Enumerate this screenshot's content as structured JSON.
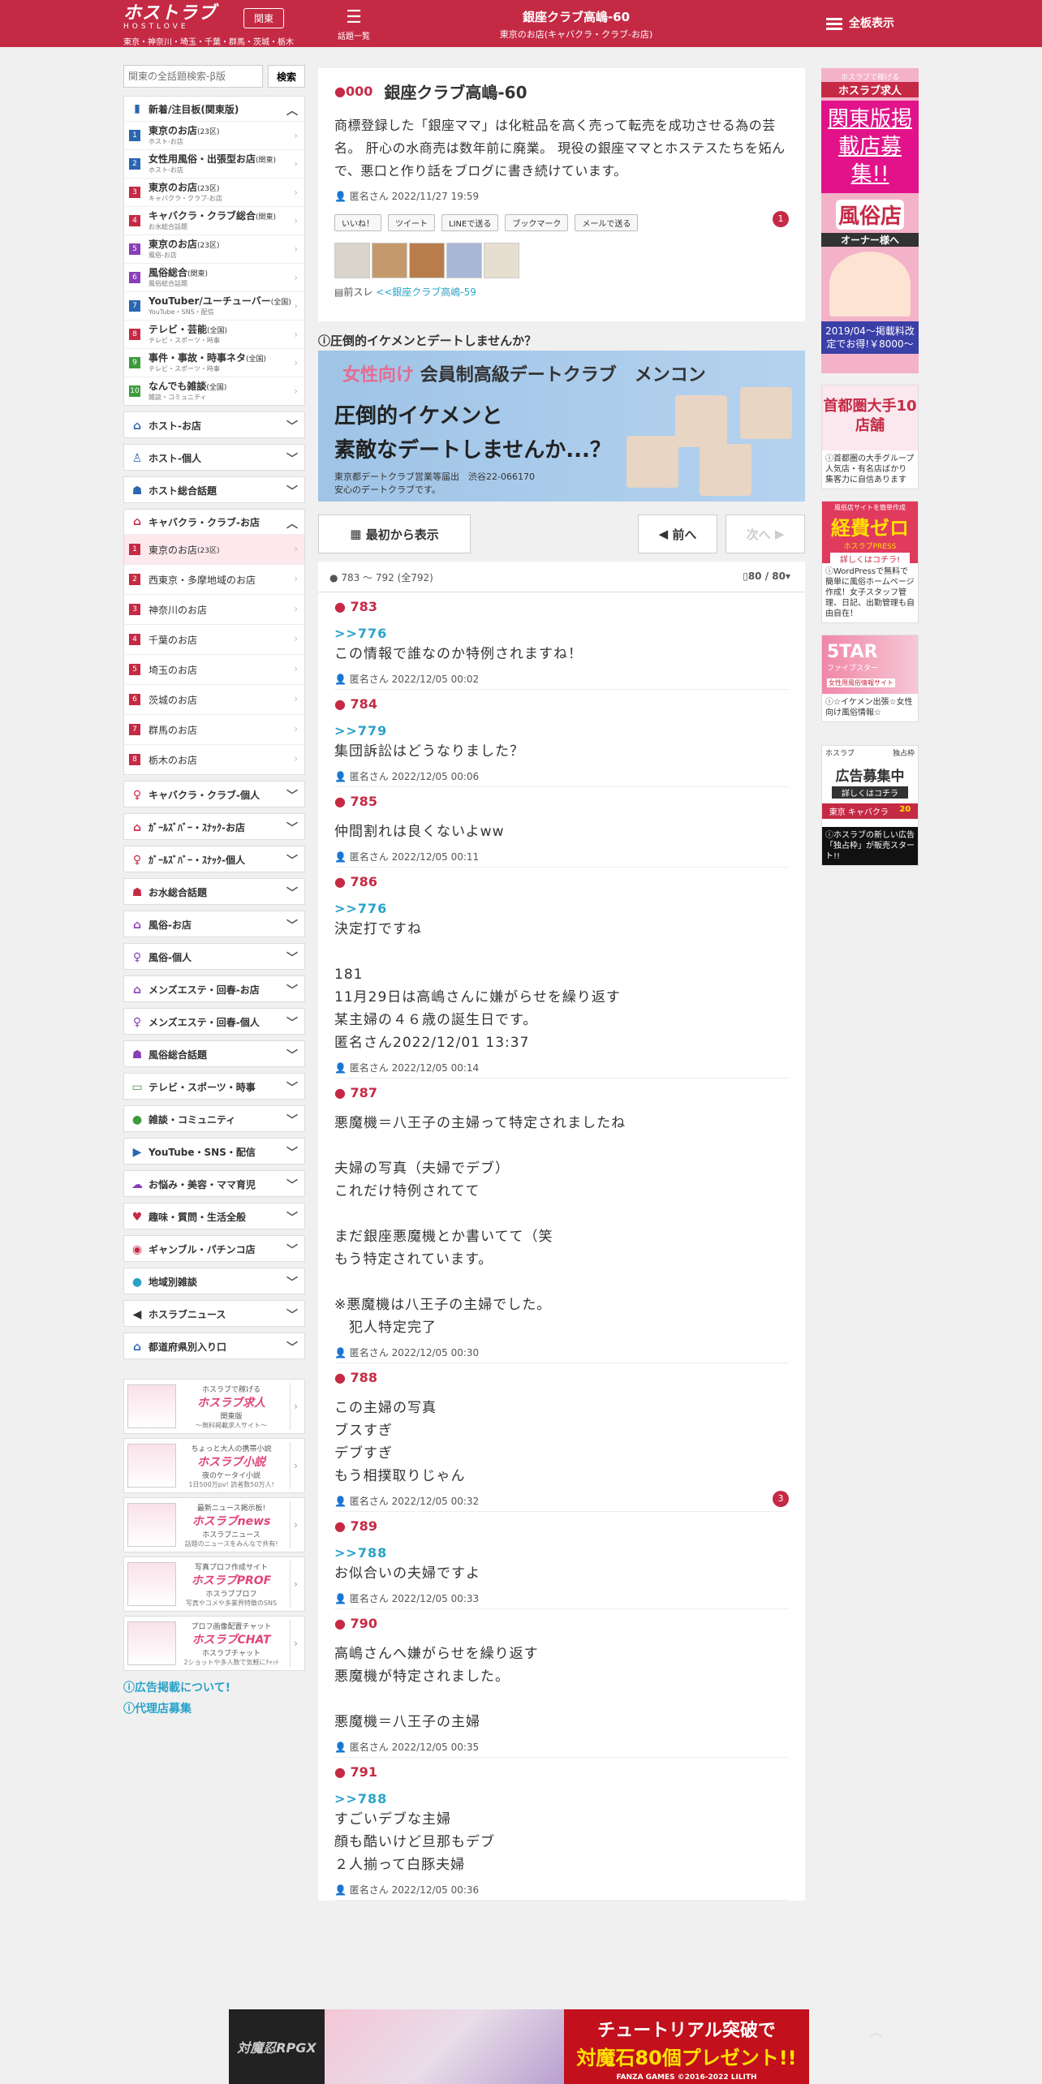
{
  "header": {
    "logo_main": "ホストラブ",
    "logo_sub": "HOSTLOVE",
    "region": "関東",
    "areas": "東京・神奈川・埼玉・千葉・群馬・茨城・栃木",
    "topics_label": "話題一覧",
    "title": "銀座クラブ高嶋-60",
    "subtitle": "東京のお店(キャバクラ・クラブ-お店)",
    "allboard": "全板表示"
  },
  "search": {
    "placeholder": "関東の全話題検索-β版",
    "button": "検索"
  },
  "sidebar": {
    "new_label": "新着/注目板(関東版)",
    "items": [
      {
        "num": "1",
        "name": "東京のお店",
        "sub_suffix": "(23区)",
        "desc": "ホスト-お店",
        "color": "#2b66b0"
      },
      {
        "num": "2",
        "name": "女性用風俗・出張型お店",
        "sub_suffix": "(関東)",
        "desc": "ホスト-お店",
        "color": "#2b66b0"
      },
      {
        "num": "3",
        "name": "東京のお店",
        "sub_suffix": "(23区)",
        "desc": "キャバクラ・クラブ-お店",
        "color": "#c52a45"
      },
      {
        "num": "4",
        "name": "キャバクラ・クラブ総合",
        "sub_suffix": "(関東)",
        "desc": "お水総合話題",
        "color": "#c52a45"
      },
      {
        "num": "5",
        "name": "東京のお店",
        "sub_suffix": "(23区)",
        "desc": "風俗-お店",
        "color": "#8a3fb8"
      },
      {
        "num": "6",
        "name": "風俗総合",
        "sub_suffix": "(関東)",
        "desc": "風俗総合話題",
        "color": "#8a3fb8"
      },
      {
        "num": "7",
        "name": "YouTuber/ユーチューバー",
        "sub_suffix": "(全国)",
        "desc": "YouTube・SNS・配信",
        "color": "#2b66b0"
      },
      {
        "num": "8",
        "name": "テレビ・芸能",
        "sub_suffix": "(全国)",
        "desc": "テレビ・スポーツ・時事",
        "color": "#c52a45"
      },
      {
        "num": "9",
        "name": "事件・事故・時事ネタ",
        "sub_suffix": "(全国)",
        "desc": "テレビ・スポーツ・時事",
        "color": "#3d9b3d"
      },
      {
        "num": "10",
        "name": "なんでも雑談",
        "sub_suffix": "(全国)",
        "desc": "雑談・コミュニティ",
        "color": "#3d9b3d"
      }
    ],
    "host_shop": "ホスト-お店",
    "host_individual": "ホスト-個人",
    "host_general": "ホスト総合話題",
    "cabaret_shop": "キャバクラ・クラブ-お店",
    "cabaret_sub": [
      "東京のお店",
      "西東京・多摩地域のお店",
      "神奈川のお店",
      "千葉のお店",
      "埼玉のお店",
      "茨城のお店",
      "群馬のお店",
      "栃木のお店"
    ],
    "tokyo_suffix": "(23区)",
    "categories": [
      "キャバクラ・クラブ-個人",
      "ｶﾞｰﾙｽﾞﾊﾞｰ・ｽﾅｯｸ-お店",
      "ｶﾞｰﾙｽﾞﾊﾞｰ・ｽﾅｯｸ-個人",
      "お水総合話題",
      "風俗-お店",
      "風俗-個人",
      "メンズエステ・回春-お店",
      "メンズエステ・回春-個人",
      "風俗総合話題",
      "テレビ・スポーツ・時事",
      "雑談・コミュニティ",
      "YouTube・SNS・配信",
      "お悩み・美容・ママ育児",
      "趣味・質問・生活全般",
      "ギャンブル・パチンコ店",
      "地域別雑談",
      "ホスラブニュース",
      "都道府県別入り口"
    ],
    "promos": [
      {
        "t1": "ホスラブで稼げる",
        "t2": "ホスラブ求人",
        "t3": "関東版",
        "t4": "〜無料掲載求人サイト〜"
      },
      {
        "t1": "ちょっと大人の携帯小説",
        "t2": "ホスラブ小説",
        "t3": "夜のケータイ小説",
        "t4": "1日500万pv! 読者数50万人!"
      },
      {
        "t1": "最新ニュース掲示板!",
        "t2": "ホスラブnews",
        "t3": "ホスラブニュース",
        "t4": "話題のニュースをみんなで共有!"
      },
      {
        "t1": "写真プロフ作成サイト",
        "t2": "ホスラブPROF",
        "t3": "ホスラブプロフ",
        "t4": "写真やコメや多業界特徴のSNS"
      },
      {
        "t1": "プロフ画像配置チャット",
        "t2": "ホスラブCHAT",
        "t3": "ホスラブチャット",
        "t4": "2ショットや多人数で気軽にﾁｬｯﾄ"
      }
    ],
    "ad_about": "広告掲載について!",
    "agency": "代理店募集"
  },
  "thread": {
    "num": "000",
    "title": "銀座クラブ高嶋-60",
    "desc": "商標登録した「銀座ママ」は化粧品を高く売って転売を成功させる為の芸名。 肝心の水商売は数年前に廃業。 現役の銀座ママとホステスたちを妬んで、悪口と作り話をブログに書き続けています。",
    "author": "匿名さん 2022/11/27 19:59",
    "count": "1",
    "shares": [
      "いいね！",
      "ツイート",
      "LINEで送る",
      "ブックマーク",
      "メールで送る"
    ],
    "prev_label": "前スレ",
    "prev_link": "<<銀座クラブ高嶋-59"
  },
  "ad": {
    "title": "圧倒的イケメンとデートしませんか？",
    "line1a": "女性向け",
    "line1b": "会員制高級デートクラブ　メンコン",
    "line2": "圧倒的イケメンと",
    "line3": "素敵なデートしませんか...？",
    "line4": "東京都デートクラブ営業等届出　渋谷22-066170",
    "line5": "安心のデートクラブです。"
  },
  "nav": {
    "first": "最初から表示",
    "prev": "前へ",
    "next": "次へ"
  },
  "list": {
    "range": "783 ～ 792",
    "total": "(全792)",
    "pages": "80 / 80"
  },
  "posts": [
    {
      "num": "783",
      "anchor": ">>776",
      "body": "この情報で誰なのか特例されますね！",
      "meta": "匿名さん 2022/12/05 00:02"
    },
    {
      "num": "784",
      "anchor": ">>779",
      "body": "集団訴訟はどうなりました？",
      "meta": "匿名さん 2022/12/05 00:06"
    },
    {
      "num": "785",
      "anchor": "",
      "body": "仲間割れは良くないよww",
      "meta": "匿名さん 2022/12/05 00:11"
    },
    {
      "num": "786",
      "anchor": ">>776",
      "body": "決定打ですね\n\n181\n11月29日は高嶋さんに嫌がらせを繰り返す\n某主婦の４６歳の誕生日です。\n匿名さん2022/12/01 13:37",
      "meta": "匿名さん 2022/12/05 00:14"
    },
    {
      "num": "787",
      "anchor": "",
      "body": "悪魔機＝八王子の主婦って特定されましたね\n\n夫婦の写真（夫婦でデブ）\nこれだけ特例されてて\n\nまだ銀座悪魔機とか書いてて（笑\nもう特定されています。\n\n※悪魔機は八王子の主婦でした。\n　犯人特定完了",
      "meta": "匿名さん 2022/12/05 00:30"
    },
    {
      "num": "788",
      "anchor": "",
      "body": "この主婦の写真\nブスすぎ\nデブすぎ\nもう相撲取りじゃん",
      "meta": "匿名さん 2022/12/05 00:32",
      "count": "3"
    },
    {
      "num": "789",
      "anchor": ">>788",
      "body": "お似合いの夫婦ですよ",
      "meta": "匿名さん 2022/12/05 00:33"
    },
    {
      "num": "790",
      "anchor": "",
      "body": "高嶋さんへ嫌がらせを繰り返す\n悪魔機が特定されました。\n\n悪魔機＝八王子の主婦",
      "meta": "匿名さん 2022/12/05 00:35"
    },
    {
      "num": "791",
      "anchor": ">>788",
      "body": "すごいデブな主婦\n顔も酷いけど旦那もデブ\n２人揃って白豚夫婦",
      "meta": "匿名さん 2022/12/05 00:36"
    }
  ],
  "right_ads": {
    "a1_top": "ホスラブで稼げる",
    "a1_brand": "ホスラブ求人",
    "a1_big": "関東版掲載店募集!!",
    "a1_mid": "風俗店",
    "a1_sub": "オーナー様へ",
    "a1_bottom": "2019/04〜掲載料改定でお得!￥8000〜",
    "a2_title": "首都圏大手10店舗",
    "a2_text": "首都圏の大手グループ 人気店・有名店ばかり 集客力に自信あります",
    "a3_top": "風俗店サイトを簡単作成",
    "a3_big": "経費ゼロ",
    "a3_brand": "ホスラブPRESS",
    "a3_btn": "詳しくはコチラ!",
    "a3_text": "WordPressで無料で簡単に風俗ホームページ作成！女子スタッフ管理、日記、出勤管理も自由自在！",
    "a4_big": "5TAR",
    "a4_sub": "ファイブスター",
    "a4_desc": "女性用風俗情報サイト",
    "a4_text": "☆イケメン出張☆女性向け風俗情報☆",
    "a5_brand": "ホスラブ",
    "a5_title": "独占枠",
    "a5_big": "広告募集中",
    "a5_btn": "詳しくはコチラ",
    "a5_area": "東京 キャバクラ",
    "a5_num": "20",
    "a5_text": "ホスラブの新しい広告「独占枠」が販売スタート!!"
  },
  "footer_ad": {
    "f1": "対魔忍RPGX",
    "f3a": "チュートリアル突破で",
    "f3b": "対魔石80個プレゼント!!",
    "f3c": "FANZA GAMES ©2016-2022 LILITH"
  }
}
